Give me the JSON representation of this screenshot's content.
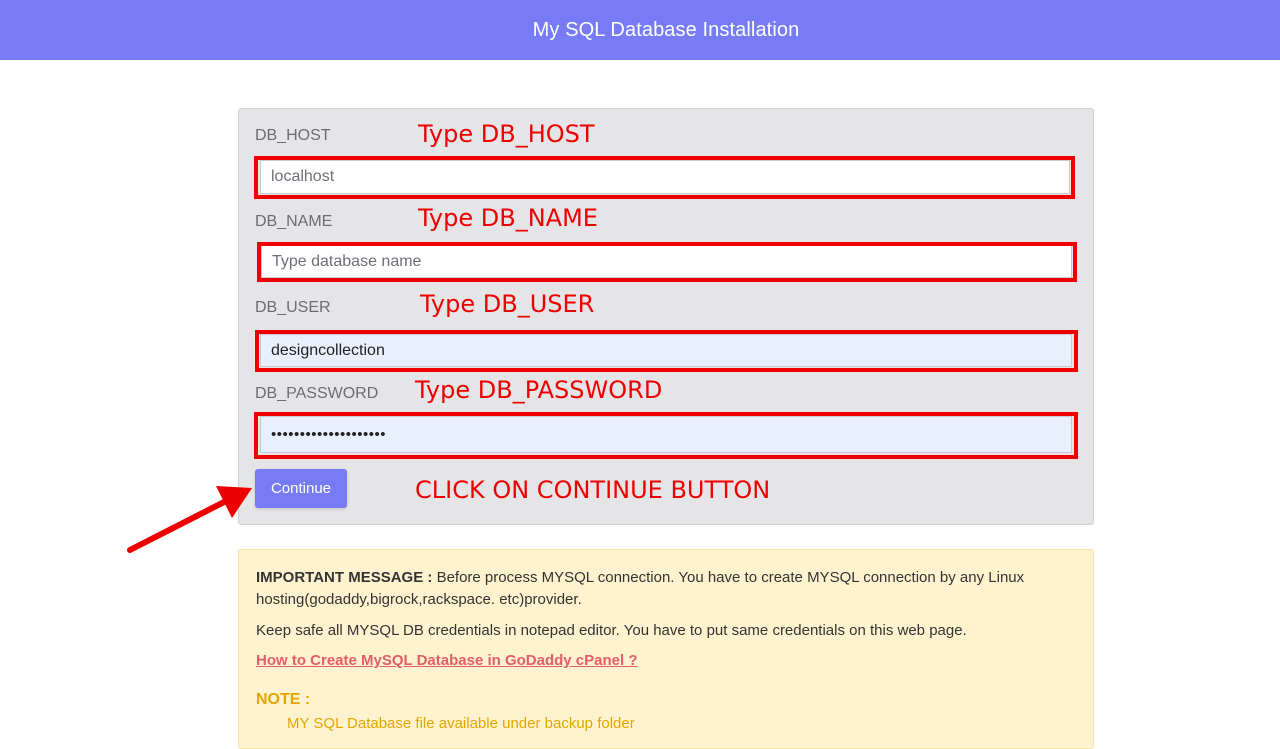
{
  "header": {
    "title": "My SQL Database Installation"
  },
  "form": {
    "fields": [
      {
        "label": "DB_HOST",
        "annotation": "Type DB_HOST",
        "value": "",
        "placeholder": "localhost"
      },
      {
        "label": "DB_NAME",
        "annotation": "Type DB_NAME",
        "value": "",
        "placeholder": "Type database name"
      },
      {
        "label": "DB_USER",
        "annotation": "Type DB_USER",
        "value": "designcollection",
        "placeholder": ""
      },
      {
        "label": "DB_PASSWORD",
        "annotation": "Type DB_PASSWORD",
        "value": "••••••••••••••••••••",
        "placeholder": ""
      }
    ],
    "continue_label": "Continue",
    "continue_annotation": "CLICK ON CONTINUE BUTTON"
  },
  "notice": {
    "important_label": "IMPORTANT MESSAGE :",
    "important_text": "Before process MYSQL connection. You have to create MYSQL connection by any Linux hosting(godaddy,bigrock,rackspace. etc)provider.",
    "keep_safe_text": "Keep safe all MYSQL DB credentials in notepad editor. You have to put same credentials on this web page.",
    "link_text": "How to Create MySQL Database in GoDaddy cPanel ?",
    "note_title": "NOTE :",
    "note_item": "MY SQL Database file available under backup folder"
  },
  "colors": {
    "header_bg": "#777cf6",
    "annotation_red": "#ee0000",
    "notice_bg": "#fff3cf",
    "link_color": "#e35d6a",
    "note_color": "#e3a600"
  }
}
